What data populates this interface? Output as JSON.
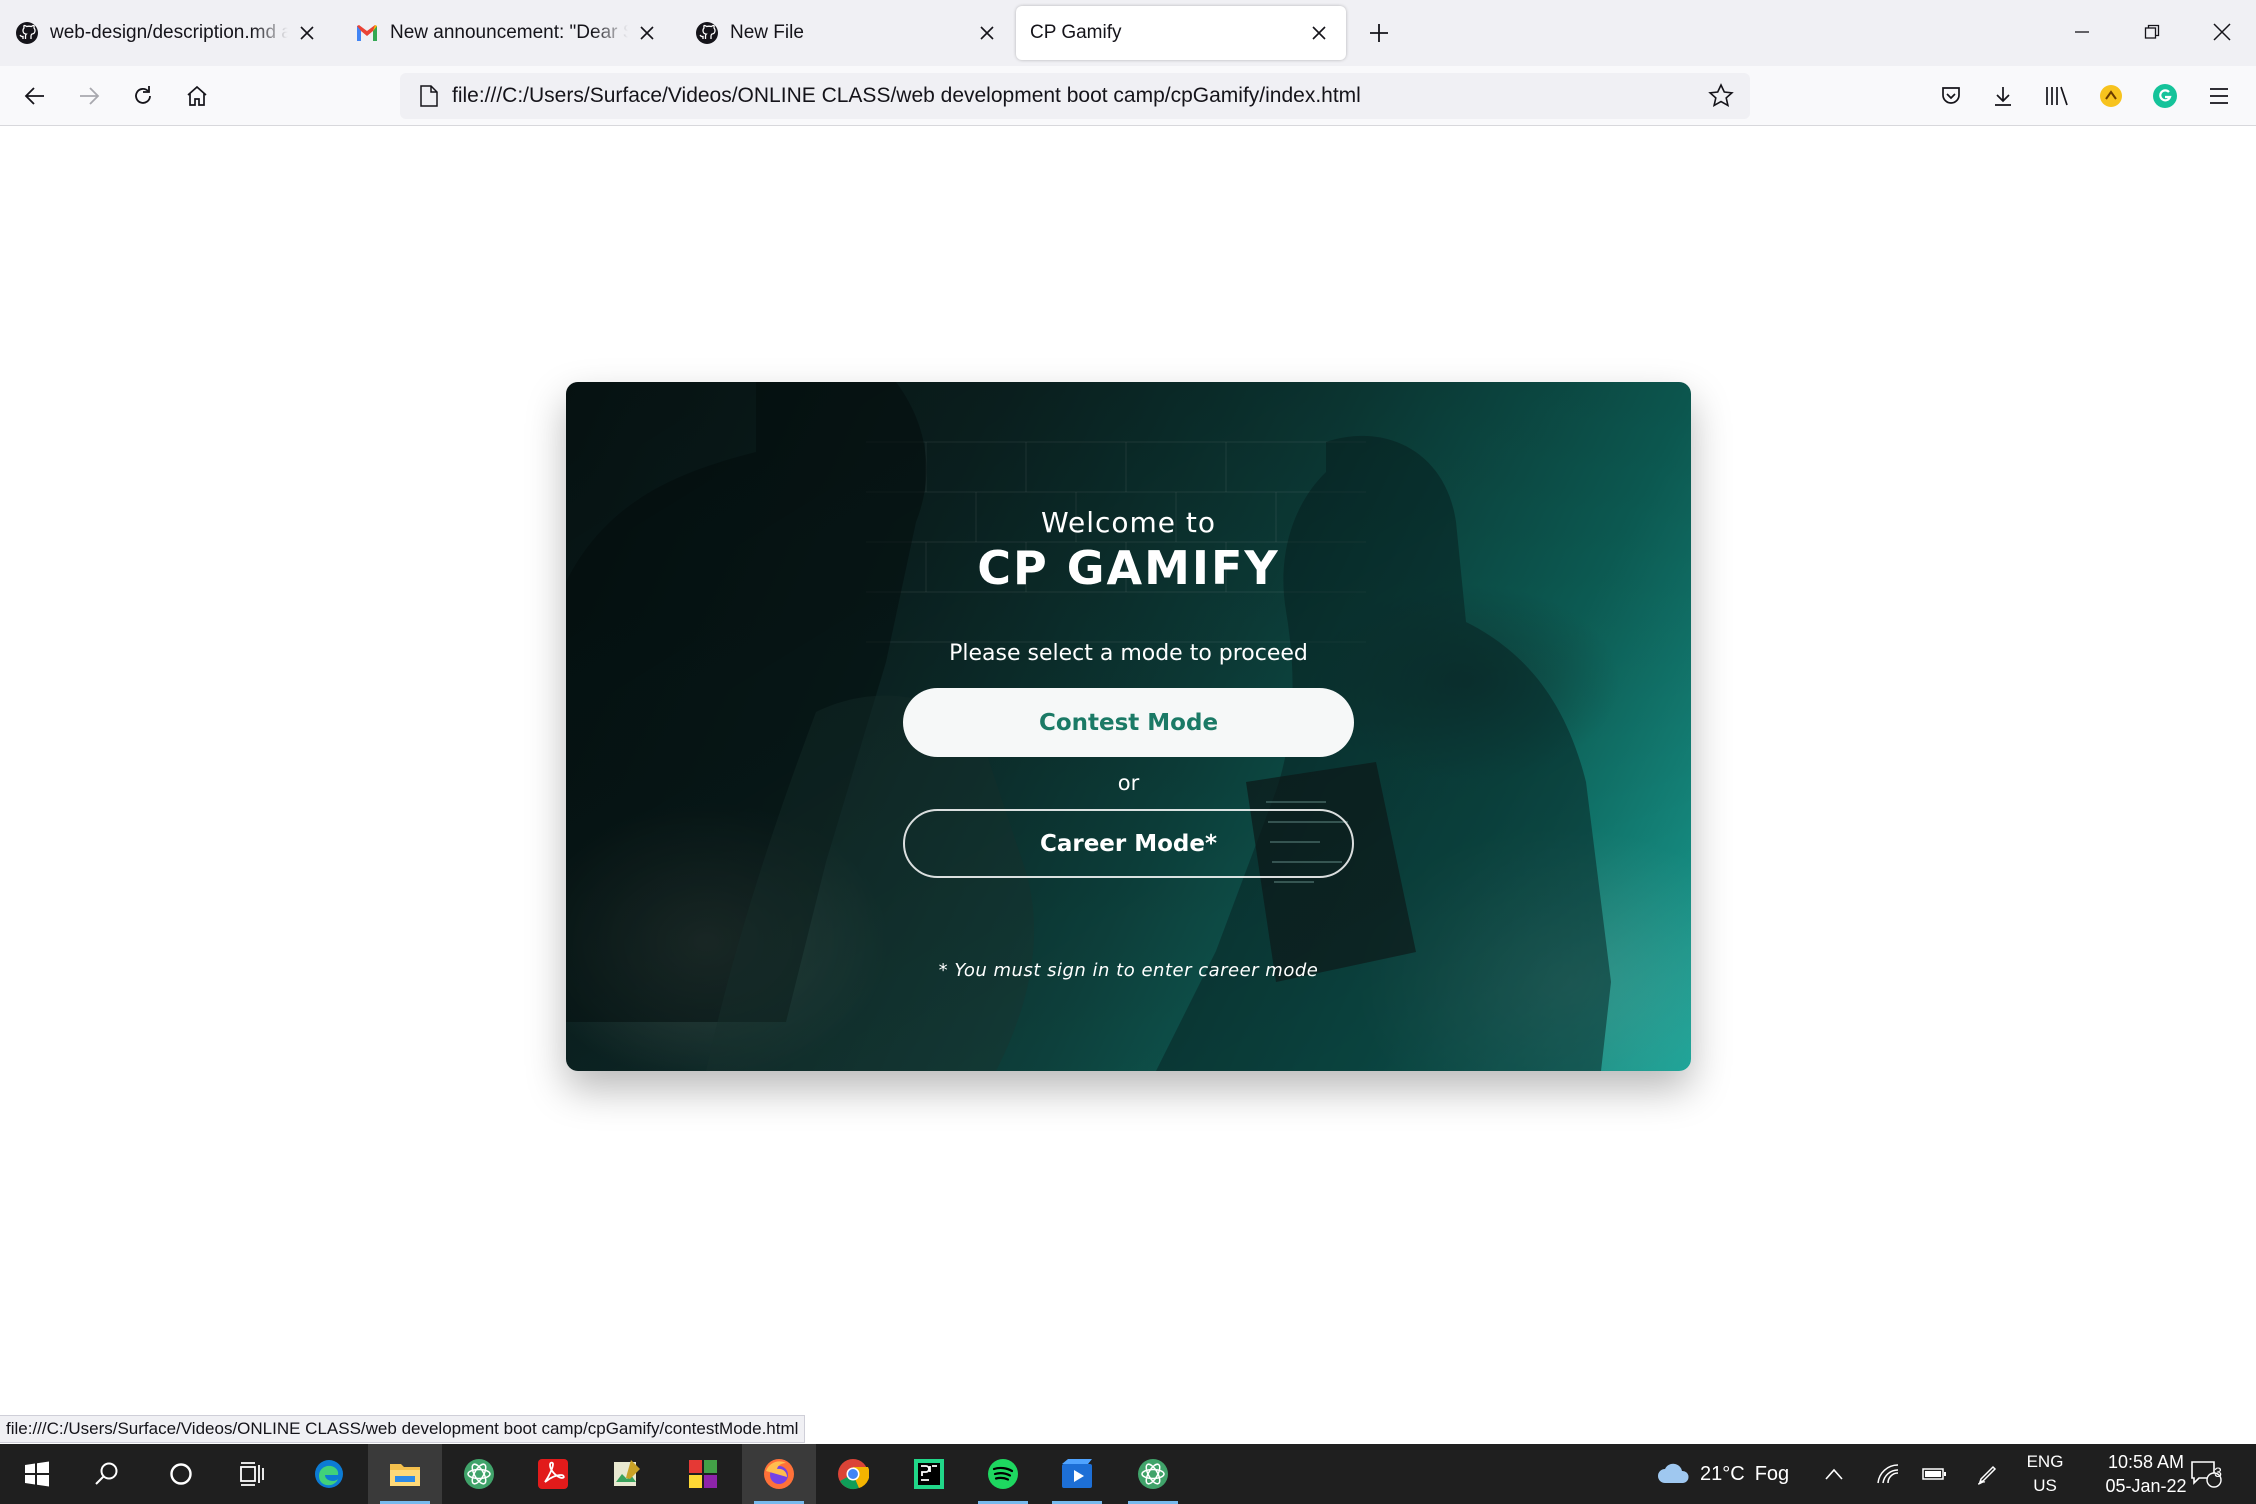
{
  "browser": {
    "tabs": [
      {
        "title": "web-design/description.md at m",
        "favicon": "github-icon"
      },
      {
        "title": "New announcement: \"Dear Stud",
        "favicon": "gmail-icon"
      },
      {
        "title": "New File",
        "favicon": "github-icon"
      },
      {
        "title": "CP Gamify",
        "favicon": "none",
        "active": true
      }
    ],
    "url": "file:///C:/Users/Surface/Videos/ONLINE CLASS/web development boot camp/cpGamify/index.html",
    "status_link": "file:///C:/Users/Surface/Videos/ONLINE CLASS/web development boot camp/cpGamify/contestMode.html"
  },
  "page": {
    "welcome": "Welcome to",
    "brand": "CP GAMIFY",
    "prompt": "Please select a mode to proceed",
    "contest_button": "Contest Mode",
    "or_label": "or",
    "career_button": "Career Mode*",
    "note": "* You must sign in to enter career mode",
    "colors": {
      "accent": "#1b7a66",
      "card_dark": "#0b1f1f",
      "card_light": "#1aa397"
    }
  },
  "taskbar": {
    "weather": {
      "temp": "21°C",
      "condition": "Fog"
    },
    "language": {
      "line1": "ENG",
      "line2": "US"
    },
    "clock": {
      "time": "10:58 AM",
      "date": "05-Jan-22"
    },
    "notification_count": "3"
  }
}
